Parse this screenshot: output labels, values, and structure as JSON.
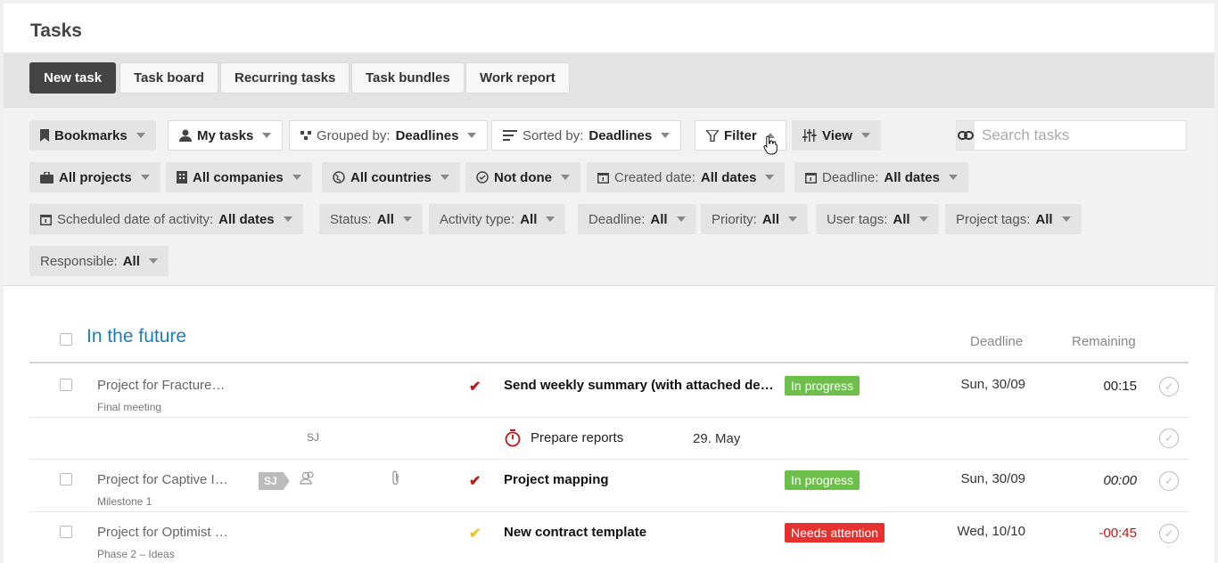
{
  "page": {
    "title": "Tasks"
  },
  "tabs": [
    {
      "label": "New task",
      "active": true
    },
    {
      "label": "Task board"
    },
    {
      "label": "Recurring tasks"
    },
    {
      "label": "Task bundles"
    },
    {
      "label": "Work report"
    }
  ],
  "filters": {
    "bookmarks": "Bookmarks",
    "my_tasks": "My tasks",
    "grouped_prefix": "Grouped by:",
    "grouped_value": "Deadlines",
    "sorted_prefix": "Sorted by:",
    "sorted_value": "Deadlines",
    "filter": "Filter",
    "view": "View",
    "search_placeholder": "Search tasks",
    "all_projects": "All projects",
    "all_companies": "All companies",
    "all_countries": "All countries",
    "not_done": "Not done",
    "created_prefix": "Created date:",
    "created_value": "All dates",
    "deadline_dates_prefix": "Deadline:",
    "deadline_dates_value": "All dates",
    "scheduled_prefix": "Scheduled date of activity:",
    "scheduled_value": "All dates",
    "status_prefix": "Status:",
    "status_value": "All",
    "activity_prefix": "Activity type:",
    "activity_value": "All",
    "deadline_prefix": "Deadline:",
    "deadline_value": "All",
    "priority_prefix": "Priority:",
    "priority_value": "All",
    "user_tags_prefix": "User tags:",
    "user_tags_value": "All",
    "project_tags_prefix": "Project tags:",
    "project_tags_value": "All",
    "responsible_prefix": "Responsible:",
    "responsible_value": "All"
  },
  "group": {
    "title": "In the future",
    "col_deadline": "Deadline",
    "col_remaining": "Remaining"
  },
  "rows": [
    {
      "project": "Project for Fracture…",
      "sub": "Final meeting",
      "title": "Send weekly summary (with attached details)",
      "status": "In progress",
      "deadline": "Sun, 30/09",
      "remaining": "00:15",
      "check_color": "#c0171b"
    },
    {
      "initials": "SJ",
      "activity": "Prepare reports",
      "activity_date": "29. May"
    },
    {
      "project": "Project for Captive I…",
      "sub": "Milestone 1",
      "tag": "SJ",
      "title": "Project mapping",
      "status": "In progress",
      "deadline": "Sun, 30/09",
      "remaining": "00:00",
      "check_color": "#c0171b"
    },
    {
      "project": "Project for Optimist …",
      "sub": "Phase 2 – Ideas",
      "title": "New contract template",
      "status": "Needs attention",
      "deadline": "Wed, 10/10",
      "remaining": "-00:45",
      "check_color": "#f2c028"
    }
  ],
  "colors": {
    "accent_blue": "#1a7dc0",
    "badge_green": "#6cc04a",
    "badge_red": "#e8302f",
    "negative_red": "#c0171b"
  }
}
